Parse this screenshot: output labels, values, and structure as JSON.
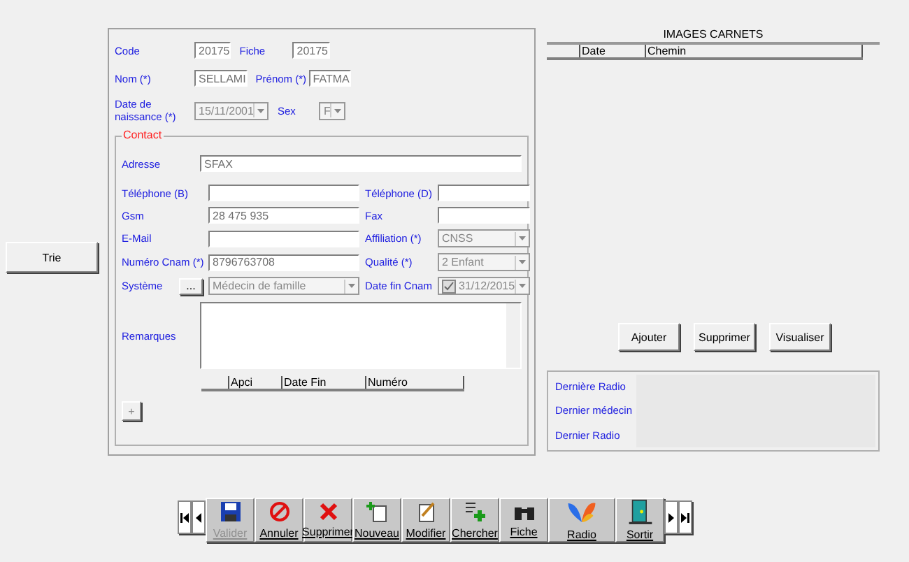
{
  "side_button": "Trie",
  "identity": [
    [
      {
        "label": "Code",
        "kind": "text",
        "value": "20175"
      },
      {
        "label": "Fiche",
        "kind": "text",
        "value": "20175"
      }
    ],
    [
      {
        "label": "Nom (*)",
        "kind": "text",
        "value": "SELLAMI"
      },
      {
        "label": "Prénom (*)",
        "kind": "text",
        "value": "FATMA"
      }
    ],
    [
      {
        "label": "Date de naissance  (*)",
        "kind": "dropdown",
        "value": "15/11/2001"
      },
      {
        "label": "Sex",
        "kind": "dropdown",
        "value": "F"
      }
    ]
  ],
  "contact": {
    "title": "Contact",
    "address": {
      "label": "Adresse",
      "value": "SFAX"
    },
    "rows": [
      [
        {
          "label": "Téléphone (B)",
          "kind": "text"
        },
        {
          "label": "Téléphone (D)",
          "kind": "text"
        }
      ],
      [
        {
          "label": "Gsm",
          "kind": "text",
          "value": "28 475 935"
        },
        {
          "label": "Fax",
          "kind": "text"
        }
      ],
      [
        {
          "label": "E-Mail",
          "kind": "text"
        },
        {
          "label": "Affiliation (*)",
          "kind": "dropdown",
          "value": "CNSS"
        }
      ],
      [
        {
          "label": "Numéro Cnam (*)",
          "kind": "text",
          "value": "8796763708"
        },
        {
          "label": "Qualité (*)",
          "kind": "dropdown",
          "value": "2 Enfant"
        }
      ],
      [
        {
          "label": "Système",
          "kind": "dropdown",
          "value": "Médecin de famille",
          "browse": "..."
        },
        {
          "label": "Date fin Cnam",
          "kind": "date",
          "value": "31/12/2015",
          "checked": true
        }
      ]
    ],
    "remarks_label": "Remarques",
    "table_columns": [
      "Apci",
      "Date Fin",
      "Numéro"
    ],
    "add_button": "+"
  },
  "images": {
    "title": "IMAGES CARNETS",
    "columns": [
      "Date",
      "Chemin"
    ],
    "buttons": [
      "Ajouter",
      "Supprimer",
      "Visualiser"
    ]
  },
  "info": {
    "labels": [
      "Dernière Radio",
      "Dernier médecin",
      "Dernier Radio"
    ]
  },
  "toolbar": [
    {
      "label": "Valider",
      "disabled": true
    },
    {
      "label": "Annuler",
      "disabled": false
    },
    {
      "label": "Supprimer",
      "disabled": false
    },
    {
      "label": "Nouveau",
      "disabled": false
    },
    {
      "label": "Modifier",
      "disabled": false
    },
    {
      "label": "Chercher",
      "disabled": false
    },
    {
      "label": "Fiche",
      "disabled": false
    },
    {
      "label": "Radio",
      "disabled": false
    },
    {
      "label": "Sortir",
      "disabled": false
    }
  ]
}
